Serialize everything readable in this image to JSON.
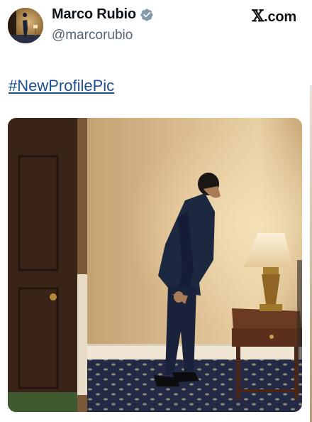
{
  "tweet": {
    "display_name": "Marco Rubio",
    "handle": "@marcorubio",
    "hashtag": "#NewProfilePic",
    "verified": true
  },
  "brand": {
    "x_glyph": "𝕏",
    "suffix": ".com"
  },
  "media": {
    "description_icon": "photo-image"
  },
  "colors": {
    "hashtag": "#1d4f91",
    "verified_badge": "#829aab",
    "handle": "#536471"
  }
}
